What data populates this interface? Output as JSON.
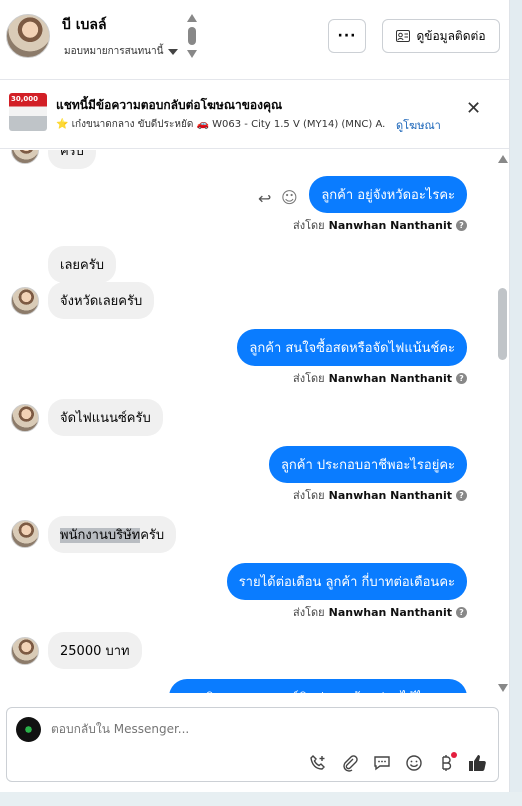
{
  "header": {
    "user_name": "บี เบลล์",
    "assign_label": "มอบหมายการสนทนานี้",
    "more_label": "···",
    "contact_label": "ดูข้อมูลติดต่อ"
  },
  "ad": {
    "thumb_text": "30,000",
    "title": "แชทนี้มีข้อความตอบกลับต่อโฆษณาของคุณ",
    "subtitle": "⭐ เก๋งขนาดกลาง ขับดีประหยัด 🚗 W063 - City 1.5 V (MY14) (MNC) A...",
    "link": "ดูโฆษณา",
    "close": "✕"
  },
  "messages": {
    "cut_top": "ครับ",
    "m1": "ลูกค้า อยู่จังหวัดอะไรคะ",
    "m2": "เลยครับ",
    "m3": "จังหวัดเลยครับ",
    "m4": "ลูกค้า สนใจซื้อสดหรือจัดไฟแน้นช์คะ",
    "m5": "จัดไฟแนนซ์ครับ",
    "m6": "ลูกค้า ประกอบอาชีพอะไรอยู่คะ",
    "m7_hl": "พนักงานบริษัท",
    "m7_rest": "ครับ",
    "m8": "รายได้ต่อเดือน  ลูกค้า กี่บาทต่อเดือนคะ",
    "m9": "25000 บาท",
    "m10_cut": "แอดมินขอความเบอร์ติดต่อ ลูกค้าหน่อยได้ไหมคะ"
  },
  "sent_by": {
    "prefix": "ส่งโดย",
    "name": "Nanwhan Nanthanit",
    "help": "?"
  },
  "composer": {
    "placeholder": "ตอบกลับใน Messenger..."
  },
  "icons": {
    "reply": "reply-icon",
    "emoji": "smiley-icon"
  }
}
